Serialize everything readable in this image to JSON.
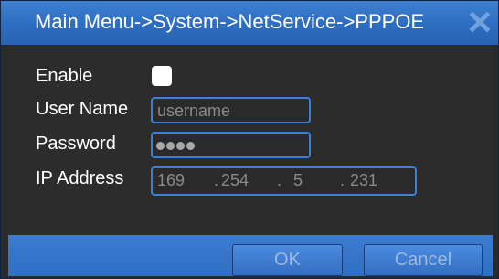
{
  "window": {
    "title": "Main Menu->System->NetService->PPPOE",
    "close_icon": "close-icon",
    "accent_color": "#2d6dc1"
  },
  "form": {
    "enable": {
      "label": "Enable",
      "checked": false
    },
    "username": {
      "label": "User Name",
      "placeholder": "username",
      "value": ""
    },
    "password": {
      "label": "Password",
      "value_masked": "●●●●",
      "length": 4
    },
    "ip_address": {
      "label": "IP Address",
      "octets": [
        "169",
        "254",
        "5",
        "231"
      ],
      "separator": "."
    }
  },
  "buttons": {
    "ok": "OK",
    "cancel": "Cancel"
  }
}
